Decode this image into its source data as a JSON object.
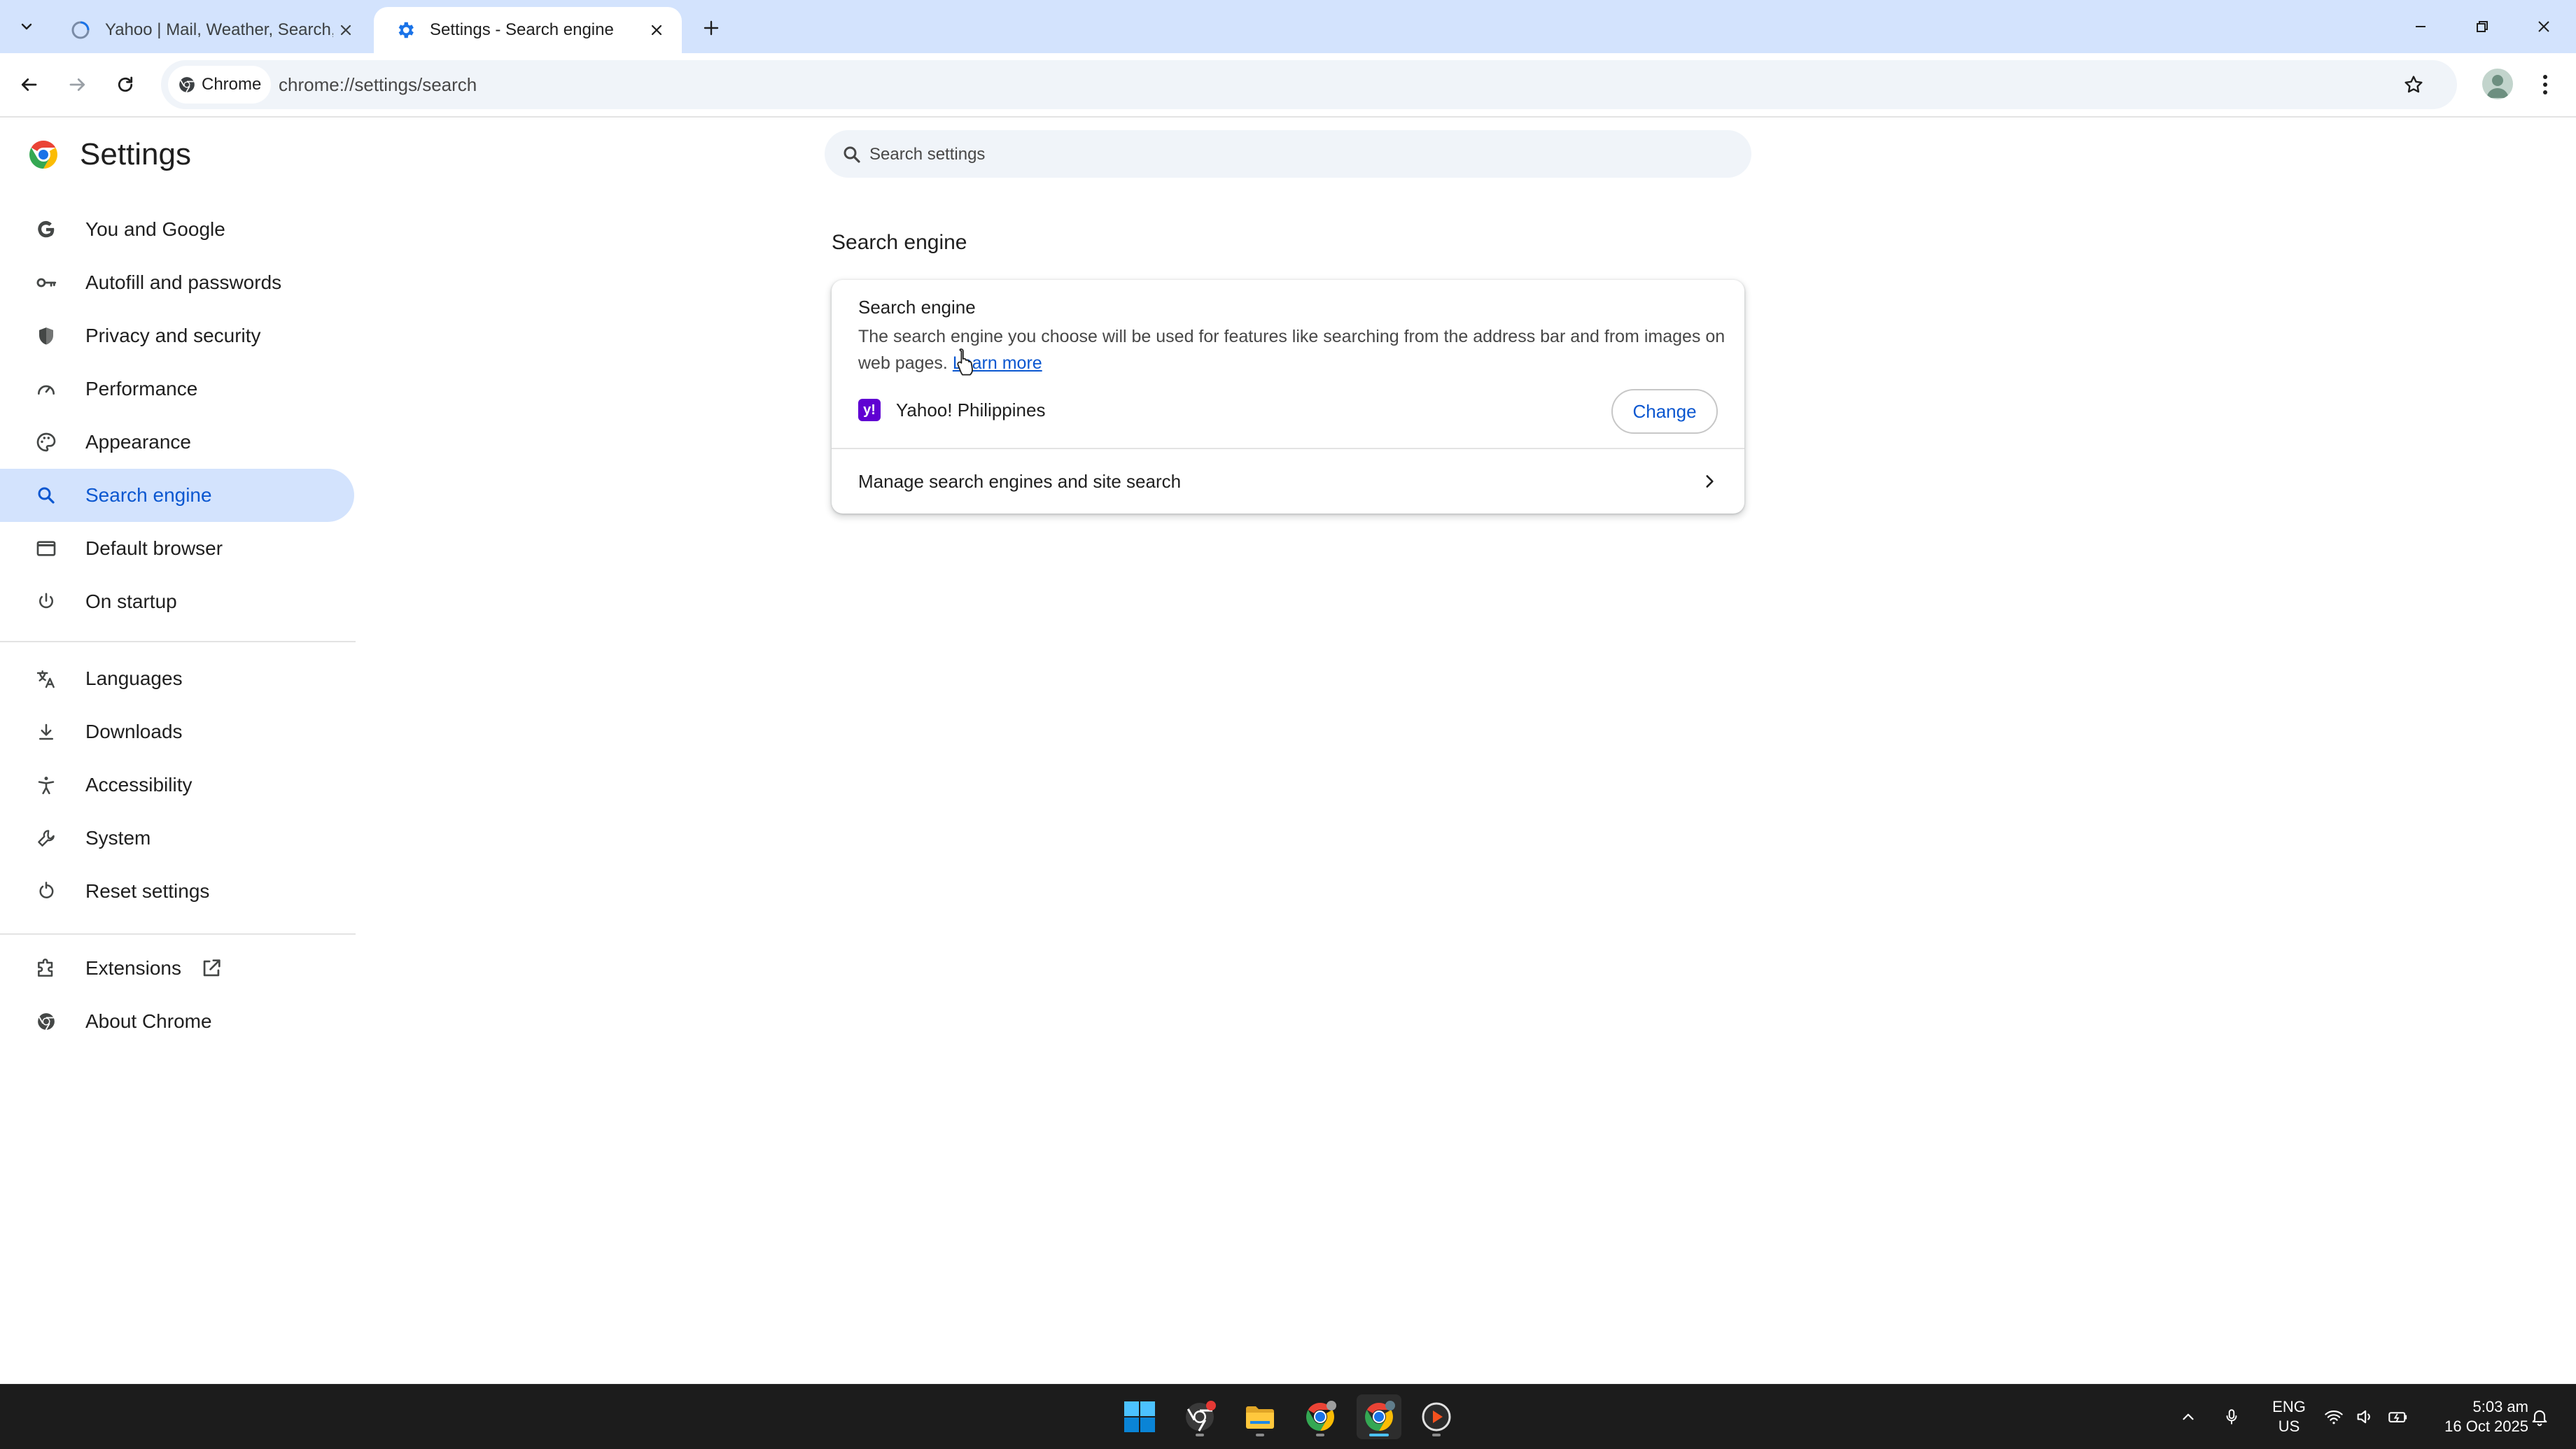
{
  "browser": {
    "tabs": [
      {
        "title": "Yahoo | Mail, Weather, Search, P",
        "active": false
      },
      {
        "title": "Settings - Search engine",
        "active": true
      }
    ],
    "chip_label": "Chrome",
    "url": "chrome://settings/search"
  },
  "sidebar": {
    "title": "Settings",
    "items": [
      {
        "label": "You and Google",
        "icon": "google-icon"
      },
      {
        "label": "Autofill and passwords",
        "icon": "key-icon"
      },
      {
        "label": "Privacy and security",
        "icon": "shield-icon"
      },
      {
        "label": "Performance",
        "icon": "speedometer-icon"
      },
      {
        "label": "Appearance",
        "icon": "palette-icon"
      },
      {
        "label": "Search engine",
        "icon": "search-icon",
        "selected": true
      },
      {
        "label": "Default browser",
        "icon": "browser-window-icon"
      },
      {
        "label": "On startup",
        "icon": "power-icon"
      },
      {
        "label": "Languages",
        "icon": "translate-icon"
      },
      {
        "label": "Downloads",
        "icon": "download-icon"
      },
      {
        "label": "Accessibility",
        "icon": "accessibility-icon"
      },
      {
        "label": "System",
        "icon": "wrench-icon"
      },
      {
        "label": "Reset settings",
        "icon": "reset-icon"
      },
      {
        "label": "Extensions",
        "icon": "puzzle-icon"
      },
      {
        "label": "About Chrome",
        "icon": "chrome-icon"
      }
    ]
  },
  "main": {
    "search_placeholder": "Search settings",
    "section_title": "Search engine",
    "card": {
      "heading": "Search engine",
      "description": "The search engine you choose will be used for features like searching from the address bar and from images on web pages.",
      "learn_more": "Learn more",
      "engine_name": "Yahoo! Philippines",
      "change_label": "Change",
      "manage_label": "Manage search engines and site search"
    }
  },
  "taskbar": {
    "lang_line1": "ENG",
    "lang_line2": "US",
    "time": "5:03 am",
    "date": "16 Oct 2025"
  },
  "colors": {
    "accent": "#0b57d0",
    "selected_bg": "#d3e3fd",
    "yahoo_purple": "#6001d2",
    "taskbar": "#1c1c1c"
  }
}
